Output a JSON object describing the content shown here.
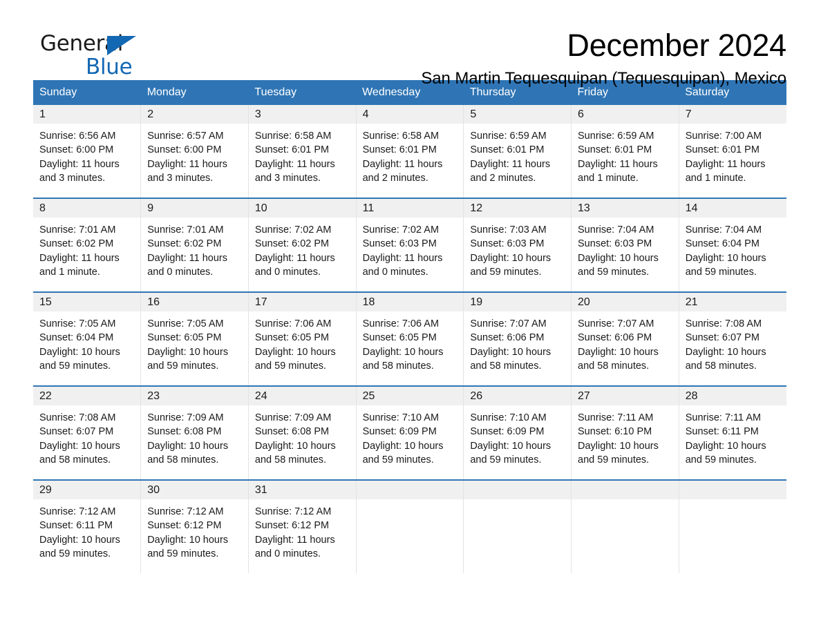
{
  "brand": {
    "name_part1": "General",
    "name_part2": "Blue",
    "accent_color": "#1268b3"
  },
  "header": {
    "month_title": "December 2024",
    "location": "San Martin Tequesquipan (Tequesquipan), Mexico"
  },
  "calendar": {
    "header_color": "#2f75b5",
    "daynum_band_color": "#f0f0f0",
    "weekday_headers": [
      "Sunday",
      "Monday",
      "Tuesday",
      "Wednesday",
      "Thursday",
      "Friday",
      "Saturday"
    ],
    "weeks": [
      [
        {
          "day": "1",
          "sunrise": "Sunrise: 6:56 AM",
          "sunset": "Sunset: 6:00 PM",
          "daylight": "Daylight: 11 hours and 3 minutes."
        },
        {
          "day": "2",
          "sunrise": "Sunrise: 6:57 AM",
          "sunset": "Sunset: 6:00 PM",
          "daylight": "Daylight: 11 hours and 3 minutes."
        },
        {
          "day": "3",
          "sunrise": "Sunrise: 6:58 AM",
          "sunset": "Sunset: 6:01 PM",
          "daylight": "Daylight: 11 hours and 3 minutes."
        },
        {
          "day": "4",
          "sunrise": "Sunrise: 6:58 AM",
          "sunset": "Sunset: 6:01 PM",
          "daylight": "Daylight: 11 hours and 2 minutes."
        },
        {
          "day": "5",
          "sunrise": "Sunrise: 6:59 AM",
          "sunset": "Sunset: 6:01 PM",
          "daylight": "Daylight: 11 hours and 2 minutes."
        },
        {
          "day": "6",
          "sunrise": "Sunrise: 6:59 AM",
          "sunset": "Sunset: 6:01 PM",
          "daylight": "Daylight: 11 hours and 1 minute."
        },
        {
          "day": "7",
          "sunrise": "Sunrise: 7:00 AM",
          "sunset": "Sunset: 6:01 PM",
          "daylight": "Daylight: 11 hours and 1 minute."
        }
      ],
      [
        {
          "day": "8",
          "sunrise": "Sunrise: 7:01 AM",
          "sunset": "Sunset: 6:02 PM",
          "daylight": "Daylight: 11 hours and 1 minute."
        },
        {
          "day": "9",
          "sunrise": "Sunrise: 7:01 AM",
          "sunset": "Sunset: 6:02 PM",
          "daylight": "Daylight: 11 hours and 0 minutes."
        },
        {
          "day": "10",
          "sunrise": "Sunrise: 7:02 AM",
          "sunset": "Sunset: 6:02 PM",
          "daylight": "Daylight: 11 hours and 0 minutes."
        },
        {
          "day": "11",
          "sunrise": "Sunrise: 7:02 AM",
          "sunset": "Sunset: 6:03 PM",
          "daylight": "Daylight: 11 hours and 0 minutes."
        },
        {
          "day": "12",
          "sunrise": "Sunrise: 7:03 AM",
          "sunset": "Sunset: 6:03 PM",
          "daylight": "Daylight: 10 hours and 59 minutes."
        },
        {
          "day": "13",
          "sunrise": "Sunrise: 7:04 AM",
          "sunset": "Sunset: 6:03 PM",
          "daylight": "Daylight: 10 hours and 59 minutes."
        },
        {
          "day": "14",
          "sunrise": "Sunrise: 7:04 AM",
          "sunset": "Sunset: 6:04 PM",
          "daylight": "Daylight: 10 hours and 59 minutes."
        }
      ],
      [
        {
          "day": "15",
          "sunrise": "Sunrise: 7:05 AM",
          "sunset": "Sunset: 6:04 PM",
          "daylight": "Daylight: 10 hours and 59 minutes."
        },
        {
          "day": "16",
          "sunrise": "Sunrise: 7:05 AM",
          "sunset": "Sunset: 6:05 PM",
          "daylight": "Daylight: 10 hours and 59 minutes."
        },
        {
          "day": "17",
          "sunrise": "Sunrise: 7:06 AM",
          "sunset": "Sunset: 6:05 PM",
          "daylight": "Daylight: 10 hours and 59 minutes."
        },
        {
          "day": "18",
          "sunrise": "Sunrise: 7:06 AM",
          "sunset": "Sunset: 6:05 PM",
          "daylight": "Daylight: 10 hours and 58 minutes."
        },
        {
          "day": "19",
          "sunrise": "Sunrise: 7:07 AM",
          "sunset": "Sunset: 6:06 PM",
          "daylight": "Daylight: 10 hours and 58 minutes."
        },
        {
          "day": "20",
          "sunrise": "Sunrise: 7:07 AM",
          "sunset": "Sunset: 6:06 PM",
          "daylight": "Daylight: 10 hours and 58 minutes."
        },
        {
          "day": "21",
          "sunrise": "Sunrise: 7:08 AM",
          "sunset": "Sunset: 6:07 PM",
          "daylight": "Daylight: 10 hours and 58 minutes."
        }
      ],
      [
        {
          "day": "22",
          "sunrise": "Sunrise: 7:08 AM",
          "sunset": "Sunset: 6:07 PM",
          "daylight": "Daylight: 10 hours and 58 minutes."
        },
        {
          "day": "23",
          "sunrise": "Sunrise: 7:09 AM",
          "sunset": "Sunset: 6:08 PM",
          "daylight": "Daylight: 10 hours and 58 minutes."
        },
        {
          "day": "24",
          "sunrise": "Sunrise: 7:09 AM",
          "sunset": "Sunset: 6:08 PM",
          "daylight": "Daylight: 10 hours and 58 minutes."
        },
        {
          "day": "25",
          "sunrise": "Sunrise: 7:10 AM",
          "sunset": "Sunset: 6:09 PM",
          "daylight": "Daylight: 10 hours and 59 minutes."
        },
        {
          "day": "26",
          "sunrise": "Sunrise: 7:10 AM",
          "sunset": "Sunset: 6:09 PM",
          "daylight": "Daylight: 10 hours and 59 minutes."
        },
        {
          "day": "27",
          "sunrise": "Sunrise: 7:11 AM",
          "sunset": "Sunset: 6:10 PM",
          "daylight": "Daylight: 10 hours and 59 minutes."
        },
        {
          "day": "28",
          "sunrise": "Sunrise: 7:11 AM",
          "sunset": "Sunset: 6:11 PM",
          "daylight": "Daylight: 10 hours and 59 minutes."
        }
      ],
      [
        {
          "day": "29",
          "sunrise": "Sunrise: 7:12 AM",
          "sunset": "Sunset: 6:11 PM",
          "daylight": "Daylight: 10 hours and 59 minutes."
        },
        {
          "day": "30",
          "sunrise": "Sunrise: 7:12 AM",
          "sunset": "Sunset: 6:12 PM",
          "daylight": "Daylight: 10 hours and 59 minutes."
        },
        {
          "day": "31",
          "sunrise": "Sunrise: 7:12 AM",
          "sunset": "Sunset: 6:12 PM",
          "daylight": "Daylight: 11 hours and 0 minutes."
        },
        {
          "day": "",
          "sunrise": "",
          "sunset": "",
          "daylight": ""
        },
        {
          "day": "",
          "sunrise": "",
          "sunset": "",
          "daylight": ""
        },
        {
          "day": "",
          "sunrise": "",
          "sunset": "",
          "daylight": ""
        },
        {
          "day": "",
          "sunrise": "",
          "sunset": "",
          "daylight": ""
        }
      ]
    ]
  }
}
